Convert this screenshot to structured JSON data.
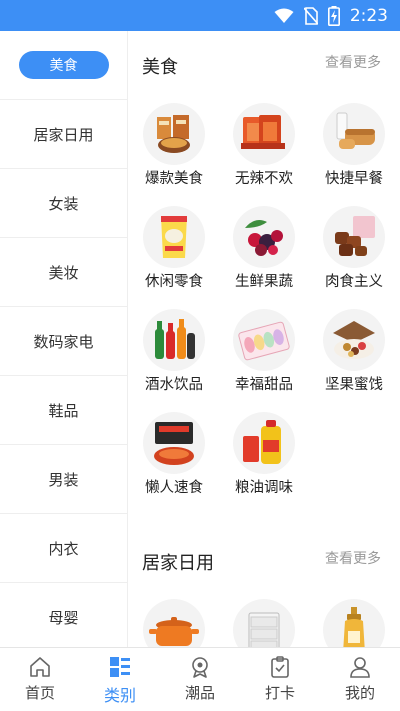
{
  "status_bar": {
    "time": "2:23",
    "icons": [
      "wifi-icon",
      "no-sim-icon",
      "battery-charging-icon"
    ]
  },
  "sidebar": {
    "items": [
      {
        "label": "美食",
        "active": true
      },
      {
        "label": "居家日用"
      },
      {
        "label": "女装"
      },
      {
        "label": "美妆"
      },
      {
        "label": "数码家电"
      },
      {
        "label": "鞋品"
      },
      {
        "label": "男装"
      },
      {
        "label": "内衣"
      },
      {
        "label": "母婴"
      }
    ]
  },
  "sections": [
    {
      "title": "美食",
      "more": "查看更多",
      "items": [
        {
          "label": "爆款美食",
          "icon": "snack-box-icon"
        },
        {
          "label": "无辣不欢",
          "icon": "spicy-strips-icon"
        },
        {
          "label": "快捷早餐",
          "icon": "bread-milk-icon"
        },
        {
          "label": "休闲零食",
          "icon": "chips-bag-icon"
        },
        {
          "label": "生鲜果蔬",
          "icon": "berries-icon"
        },
        {
          "label": "肉食主义",
          "icon": "meat-cubes-icon"
        },
        {
          "label": "酒水饮品",
          "icon": "drink-bottles-icon"
        },
        {
          "label": "幸福甜品",
          "icon": "macaron-box-icon"
        },
        {
          "label": "坚果蜜饯",
          "icon": "nuts-box-icon"
        },
        {
          "label": "懒人速食",
          "icon": "instant-noodle-icon"
        },
        {
          "label": "粮油调味",
          "icon": "cooking-oil-icon"
        }
      ]
    },
    {
      "title": "居家日用",
      "more": "查看更多",
      "items": [
        {
          "label": "",
          "icon": "cooking-pot-icon"
        },
        {
          "label": "",
          "icon": "storage-drawer-icon"
        },
        {
          "label": "",
          "icon": "shampoo-bottle-icon"
        }
      ]
    }
  ],
  "tab_bar": {
    "tabs": [
      {
        "label": "首页",
        "icon": "home-icon"
      },
      {
        "label": "类别",
        "icon": "category-icon",
        "active": true
      },
      {
        "label": "潮品",
        "icon": "trend-badge-icon"
      },
      {
        "label": "打卡",
        "icon": "checkin-icon"
      },
      {
        "label": "我的",
        "icon": "profile-icon"
      }
    ]
  },
  "colors": {
    "accent": "#3d8ff5",
    "divider": "#eeeeee",
    "more_text": "#999999"
  }
}
